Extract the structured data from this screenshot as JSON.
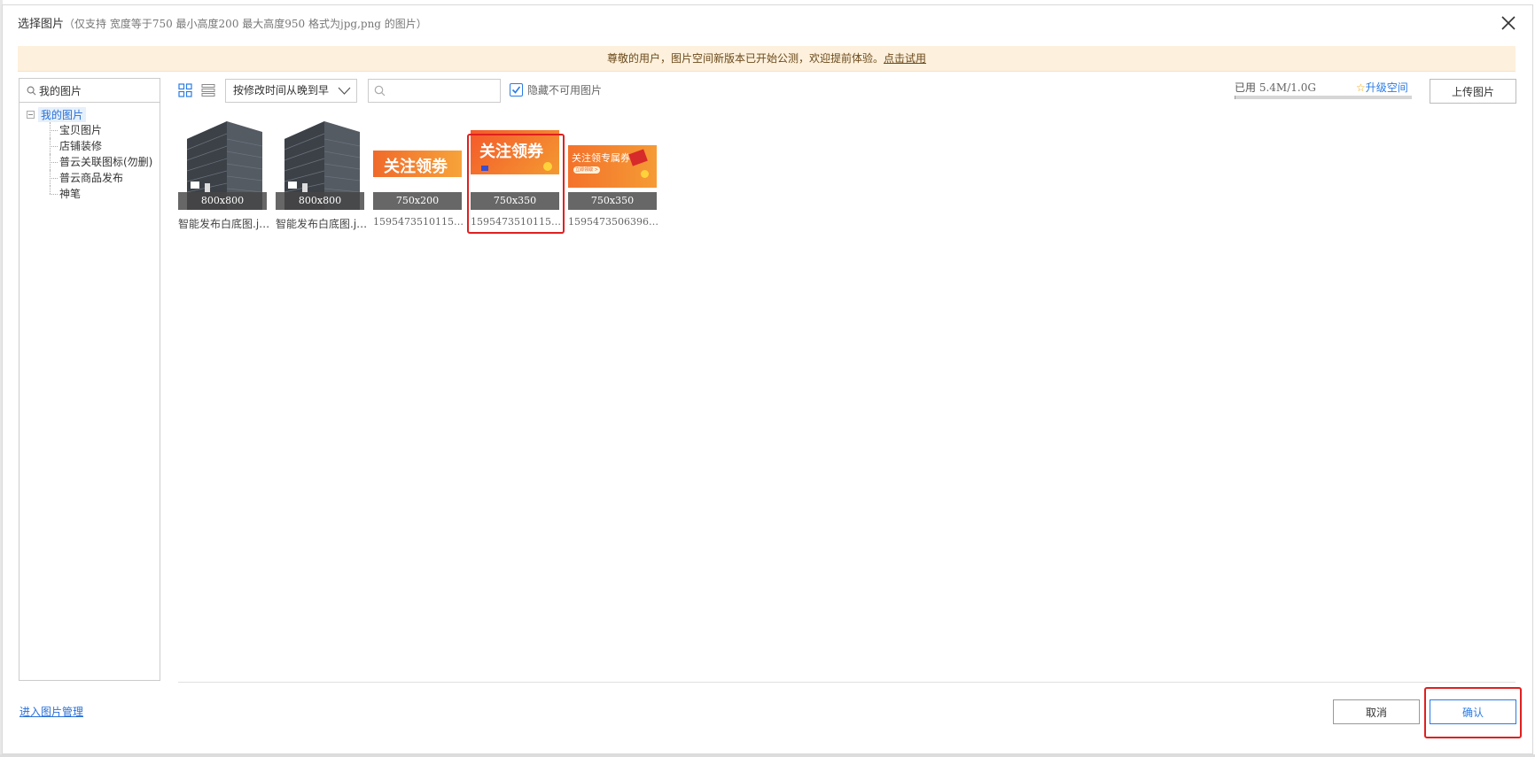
{
  "dialog": {
    "title": "选择图片",
    "hint": "（仅支持 宽度等于750 最小高度200 最大高度950 格式为jpg,png 的图片）"
  },
  "notice": {
    "text": "尊敬的用户，图片空间新版本已开始公测，欢迎提前体验。",
    "link": "点击试用"
  },
  "sidebar": {
    "search_label": "我的图片",
    "root": "我的图片",
    "items": [
      "宝贝图片",
      "店铺装修",
      "普云关联图标(勿删)",
      "普云商品发布",
      "神笔"
    ]
  },
  "toolbar": {
    "sort_value": "按修改时间从晚到早",
    "search_value": "",
    "hide_unavailable_label": "隐藏不可用图片",
    "hide_unavailable_checked": true,
    "usage_label": "已用",
    "usage_value": "5.4M/1.0G",
    "usage_fraction": 0.0053,
    "upgrade_label": "升级空间",
    "upload_label": "上传图片"
  },
  "images": [
    {
      "dims": "800x800",
      "name": "智能发布白底图.jpg"
    },
    {
      "dims": "800x800",
      "name": "智能发布白底图.jpg"
    },
    {
      "dims": "750x200",
      "name": "1595473510115-..."
    },
    {
      "dims": "750x350",
      "name": "1595473510115-...",
      "selected": true
    },
    {
      "dims": "750x350",
      "name": "1595473506396-..."
    }
  ],
  "banners": {
    "follow_coupon": "关注领劵",
    "follow_coupon_alt": "关注领券",
    "follow_service": "关注领专属券",
    "follow_service_small": "立即领取 >"
  },
  "footer": {
    "manage_link": "进入图片管理",
    "cancel": "取消",
    "confirm": "确认"
  },
  "colors": {
    "accent": "#2a7be4",
    "highlight": "#e02020",
    "notice_bg": "#fdf0dc"
  }
}
